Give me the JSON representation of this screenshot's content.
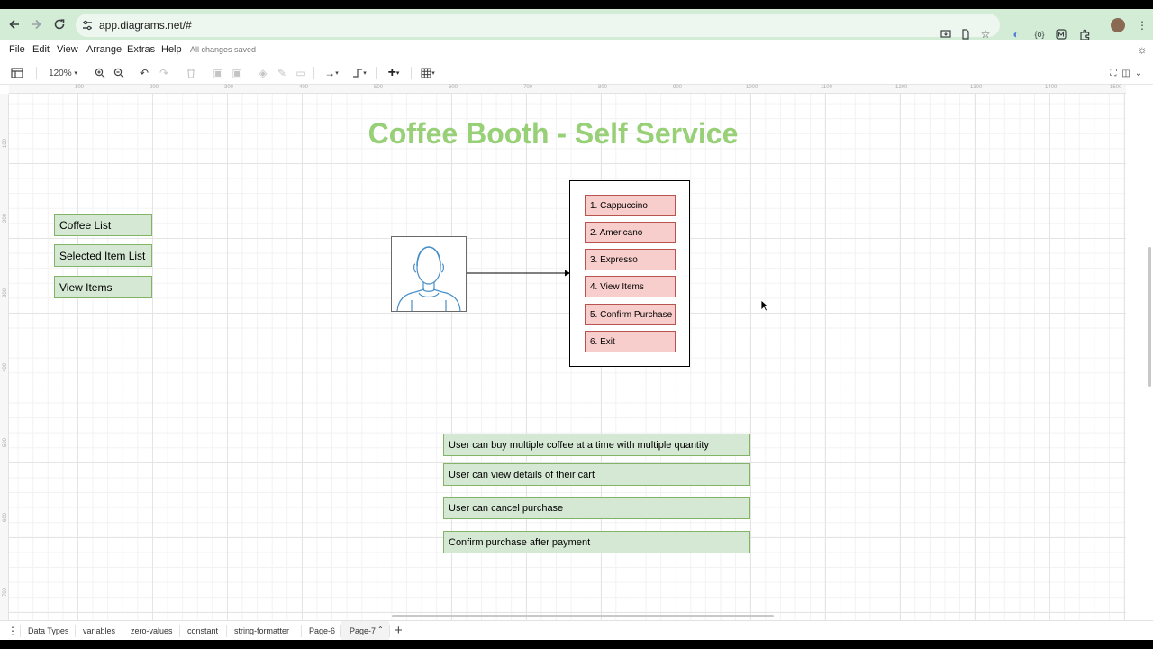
{
  "browser": {
    "url": "app.diagrams.net/#",
    "icons": [
      "back-arrow-icon",
      "forward-arrow-icon",
      "reload-icon",
      "site-settings-icon",
      "install-app-icon",
      "page-icon",
      "bookmark-star-icon",
      "extension-icon",
      "code-extension-icon",
      "m-extension-icon",
      "puzzle-extensions-icon",
      "profile-avatar",
      "more-vert-icon"
    ]
  },
  "menubar": {
    "items": [
      "File",
      "Edit",
      "View",
      "Arrange",
      "Extras",
      "Help"
    ],
    "status": "All changes saved"
  },
  "toolbar": {
    "zoom": "120%"
  },
  "ruler": {
    "h_ticks": [
      "100",
      "200",
      "300",
      "400",
      "500",
      "600",
      "700",
      "800",
      "900",
      "1000",
      "1100",
      "1200",
      "1300",
      "1400",
      "1500"
    ],
    "v_ticks": [
      "100",
      "200",
      "300",
      "400",
      "500",
      "600",
      "700"
    ]
  },
  "diagram": {
    "title": "Coffee Booth - Self Service",
    "title_color": "#97d077",
    "left_items": [
      "Coffee List",
      "Selected Item List",
      "View Items"
    ],
    "menu_items": [
      "1. Cappuccino",
      "2. Americano",
      "3. Expresso",
      "4. View Items",
      "5. Confirm Purchase",
      "6. Exit"
    ],
    "requirements": [
      "User can buy multiple coffee at a time with multiple quantity",
      "User can view details of their cart",
      "User can cancel purchase",
      "Confirm purchase after payment"
    ],
    "green_fill": "#d5e8d4",
    "green_stroke": "#82b366",
    "red_fill": "#f8cecc",
    "red_stroke": "#b85450",
    "user_icon_color": "#4a90c8"
  },
  "pages": {
    "tabs": [
      "Data Types",
      "variables",
      "zero-values",
      "constant",
      "string-formatter",
      "Page-6",
      "Page-7"
    ],
    "active": "Page-7"
  }
}
